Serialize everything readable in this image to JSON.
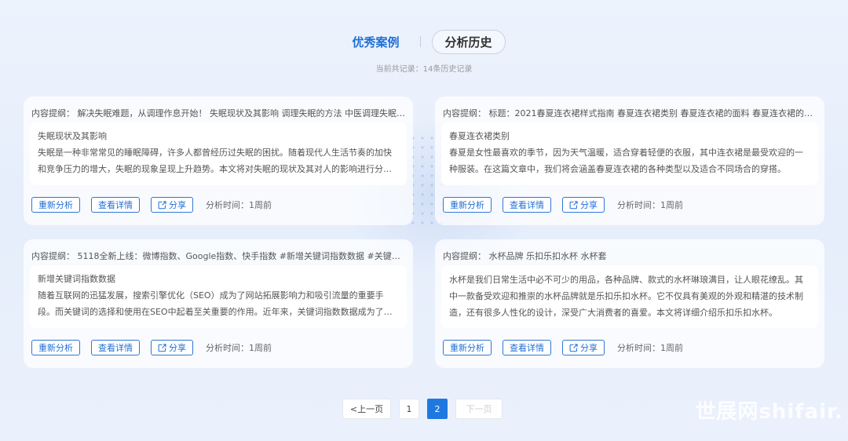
{
  "tabs": {
    "active": "优秀案例",
    "history": "分析历史"
  },
  "record_count": "当前共记录：14条历史记录",
  "cards": [
    {
      "header": "内容提纲： 解决失眠难题，从调理作息开始！ 失眠现状及其影响 调理失眠的方法 中医调理失眠的方法",
      "title": "失眠现状及其影响",
      "text": "失眠是一种非常常见的睡眠障碍，许多人都曾经历过失眠的困扰。随着现代人生活节奏的加快和竞争压力的增大，失眠的现象呈现上升趋势。本文将对失眠的现状及其对人的影响进行分析。",
      "reanalyze": "重新分析",
      "details": "查看详情",
      "share": "分享",
      "time": "分析时间：1周前"
    },
    {
      "header": "内容提纲： 标题：2021春夏连衣裙样式指南 春夏连衣裙类别 春夏连衣裙的面料 春夏连衣裙的搭配",
      "title": "春夏连衣裙类别",
      "text": "春夏是女性最喜欢的季节，因为天气温暖，适合穿着轻便的衣服，其中连衣裙是最受欢迎的一种服装。在这篇文章中，我们将会涵盖春夏连衣裙的各种类型以及适合不同场合的穿搭。",
      "reanalyze": "重新分析",
      "details": "查看详情",
      "share": "分享",
      "time": "分析时间：1周前"
    },
    {
      "header": "内容提纲： 5118全新上线：微博指数、Google指数、快手指数 #新增关键词指数数据 #关键词指数数据",
      "title": "新增关键词指数数据",
      "text": "随着互联网的迅猛发展，搜索引擎优化（SEO）成为了网站拓展影响力和吸引流量的重要手段。而关键词的选择和使用在SEO中起着至关重要的作用。近年来，关键词指数数据成为了重要参考。",
      "reanalyze": "重新分析",
      "details": "查看详情",
      "share": "分享",
      "time": "分析时间：1周前"
    },
    {
      "header": "内容提纲： 水杯品牌 乐扣乐扣水杯 水杯套",
      "title": "",
      "text": "水杯是我们日常生活中必不可少的用品，各种品牌、款式的水杯琳琅满目，让人眼花缭乱。其中一款备受欢迎和推崇的水杯品牌就是乐扣乐扣水杯。它不仅具有美观的外观和精湛的技术制造，还有很多人性化的设计，深受广大消费者的喜爱。本文将详细介绍乐扣乐扣水杯。",
      "reanalyze": "重新分析",
      "details": "查看详情",
      "share": "分享",
      "time": "分析时间：1周前"
    }
  ],
  "pagination": {
    "prev": "<上一页",
    "pages": [
      "1",
      "2"
    ],
    "current": "2",
    "next": "下一页"
  },
  "watermark": "世展网shifair.",
  "colors": {
    "accent": "#1f6fd6",
    "current_page": "#1f78e0"
  },
  "icons": {
    "share": "share-icon"
  }
}
